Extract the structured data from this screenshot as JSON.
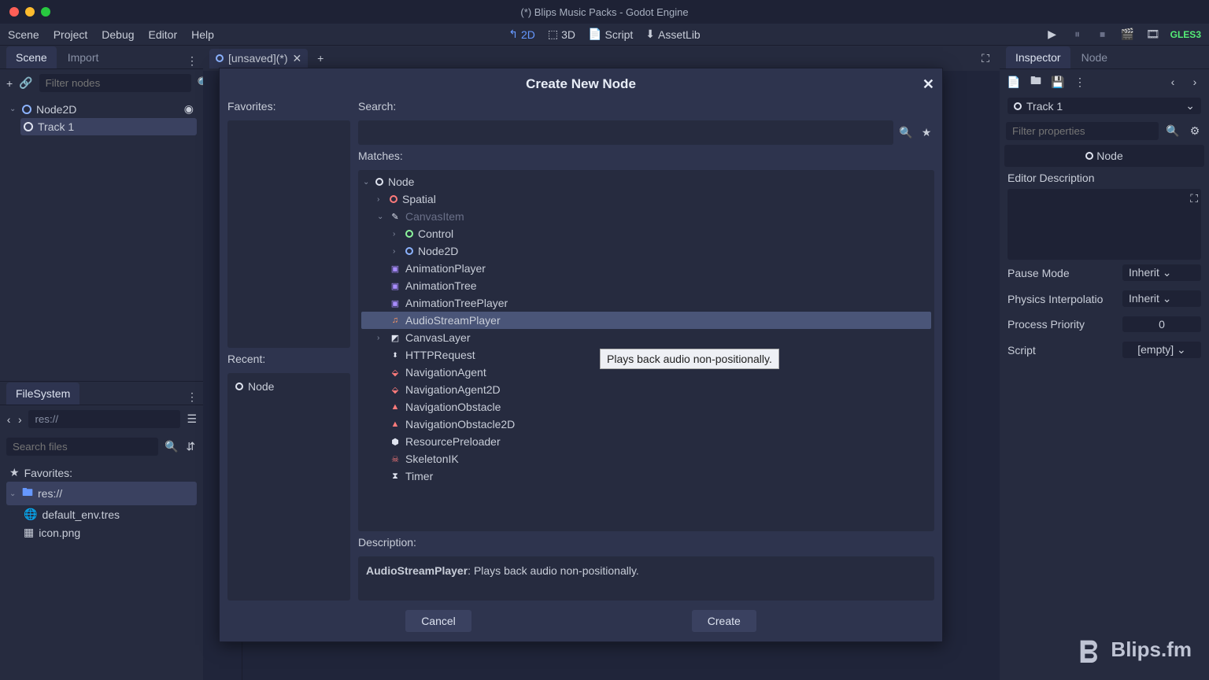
{
  "window": {
    "title": "(*) Blips Music Packs - Godot Engine"
  },
  "menu": {
    "items": [
      "Scene",
      "Project",
      "Debug",
      "Editor",
      "Help"
    ]
  },
  "viewport": {
    "tab2d": "2D",
    "tab3d": "3D",
    "script": "Script",
    "assetlib": "AssetLib"
  },
  "renderer": "GLES3",
  "scene_panel": {
    "tab_scene": "Scene",
    "tab_import": "Import",
    "filter_placeholder": "Filter nodes",
    "root": "Node2D",
    "child": "Track 1"
  },
  "editor_tab": "[unsaved](*)",
  "fs": {
    "title": "FileSystem",
    "path": "res://",
    "search_placeholder": "Search files",
    "favorites": "Favorites:",
    "root": "res://",
    "file1": "default_env.tres",
    "file2": "icon.png"
  },
  "inspector": {
    "tab_inspector": "Inspector",
    "tab_node": "Node",
    "selected": "Track 1",
    "filter_placeholder": "Filter properties",
    "type_label": "Node",
    "editor_desc": "Editor Description",
    "pause_mode": "Pause Mode",
    "pause_mode_val": "Inherit",
    "physics_interp": "Physics Interpolatio",
    "physics_interp_val": "Inherit",
    "process_priority": "Process Priority",
    "process_priority_val": "0",
    "script": "Script",
    "script_val": "[empty]"
  },
  "modal": {
    "title": "Create New Node",
    "favorites_label": "Favorites:",
    "recent_label": "Recent:",
    "recent_item": "Node",
    "search_label": "Search:",
    "matches_label": "Matches:",
    "desc_label": "Description:",
    "desc_name": "AudioStreamPlayer",
    "desc_text": ": Plays back audio non-positionally.",
    "cancel": "Cancel",
    "create": "Create",
    "nodes": {
      "node": "Node",
      "spatial": "Spatial",
      "canvasitem": "CanvasItem",
      "control": "Control",
      "node2d": "Node2D",
      "animplayer": "AnimationPlayer",
      "animtree": "AnimationTree",
      "animtreeplayer": "AnimationTreePlayer",
      "audiostream": "AudioStreamPlayer",
      "canvaslayer": "CanvasLayer",
      "httprequest": "HTTPRequest",
      "navagent": "NavigationAgent",
      "navagent2d": "NavigationAgent2D",
      "navobstacle": "NavigationObstacle",
      "navobstacle2d": "NavigationObstacle2D",
      "respreloader": "ResourcePreloader",
      "skeletonik": "SkeletonIK",
      "timer": "Timer"
    }
  },
  "tooltip": "Plays back audio non-positionally.",
  "watermark": "Blips.fm"
}
